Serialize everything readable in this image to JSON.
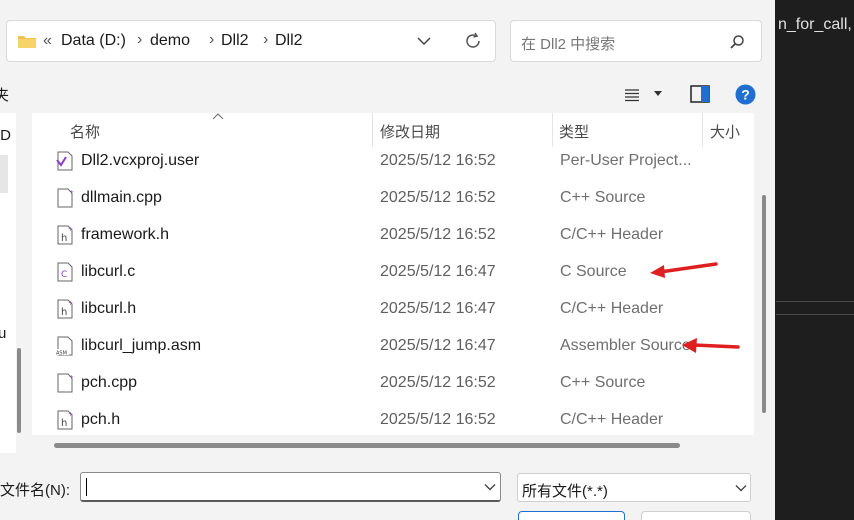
{
  "address_bar": {
    "overflow_glyph": "«",
    "crumbs": [
      "Data (D:)",
      "demo",
      "Dll2",
      "Dll2"
    ],
    "separator": "›"
  },
  "search": {
    "placeholder": "在 Dll2 中搜索"
  },
  "toolbar": {
    "left_text": "夹"
  },
  "left_pane": {
    "fragments": [
      "[D",
      "u"
    ]
  },
  "columns": {
    "name": "名称",
    "date": "修改日期",
    "type": "类型",
    "size": "大小"
  },
  "files": [
    {
      "name": "Dll2.vcxproj.user",
      "date": "2025/5/12 16:52",
      "type": "Per-User Project...",
      "icon": "vs-project-icon"
    },
    {
      "name": "dllmain.cpp",
      "date": "2025/5/12 16:52",
      "type": "C++ Source",
      "icon": "cpp-file-icon"
    },
    {
      "name": "framework.h",
      "date": "2025/5/12 16:52",
      "type": "C/C++ Header",
      "icon": "header-file-icon"
    },
    {
      "name": "libcurl.c",
      "date": "2025/5/12 16:47",
      "type": "C Source",
      "icon": "c-file-icon"
    },
    {
      "name": "libcurl.h",
      "date": "2025/5/12 16:47",
      "type": "C/C++ Header",
      "icon": "header-file-icon"
    },
    {
      "name": "libcurl_jump.asm",
      "date": "2025/5/12 16:47",
      "type": "Assembler Source",
      "icon": "asm-file-icon"
    },
    {
      "name": "pch.cpp",
      "date": "2025/5/12 16:52",
      "type": "C++ Source",
      "icon": "cpp-file-icon"
    },
    {
      "name": "pch.h",
      "date": "2025/5/12 16:52",
      "type": "C/C++ Header",
      "icon": "header-file-icon"
    }
  ],
  "footer": {
    "filename_label": "文件名(N):",
    "filename_value": "",
    "filetype_value": "所有文件(*.*)"
  },
  "editor": {
    "text": "n_for_call, l"
  },
  "colors": {
    "arrow": "#e02020",
    "accent": "#1e6fd0",
    "folder": "#f2c14e"
  }
}
